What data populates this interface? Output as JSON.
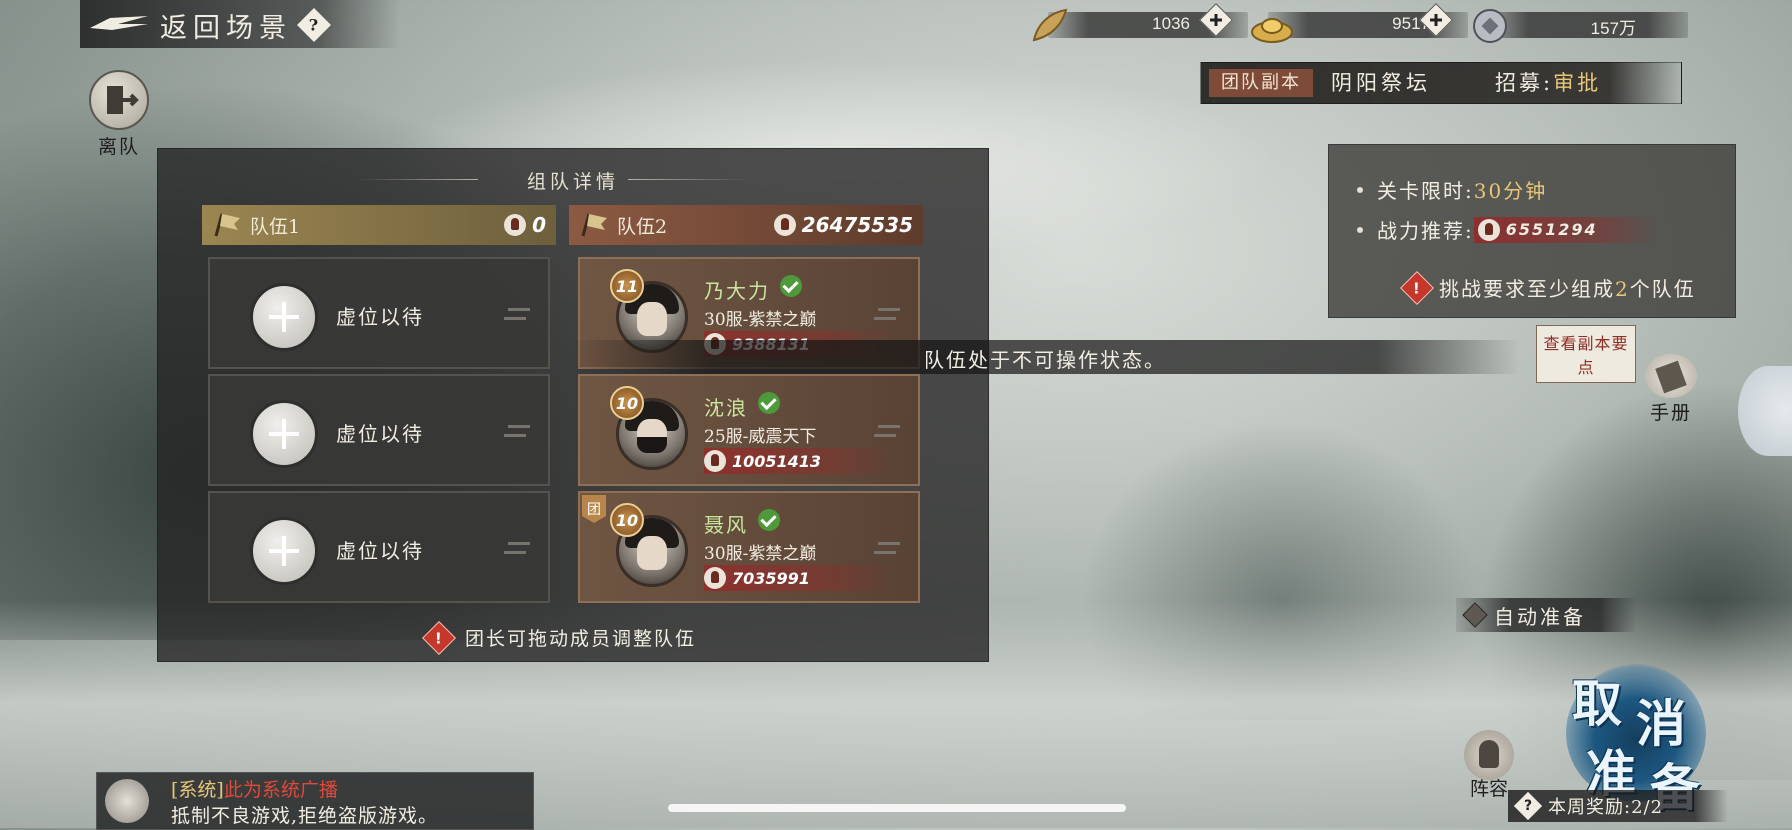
{
  "header": {
    "back_label": "返回场景",
    "help_label": "?"
  },
  "currencies": [
    {
      "icon": "leaf-currency-icon",
      "value": "1036"
    },
    {
      "icon": "gold-ingot-icon",
      "value": "9517"
    },
    {
      "icon": "coin-icon",
      "value": "157万"
    }
  ],
  "dungeon": {
    "tag": "团队副本",
    "name": "阴阳祭坛",
    "recruit_label": "招募:",
    "recruit_value": "审批"
  },
  "leave": {
    "label": "离队"
  },
  "panel": {
    "title": "组队详情",
    "hint": "团长可拖动成员调整队伍",
    "teams": [
      {
        "name": "队伍1",
        "power": "0",
        "slots": [
          {
            "label": "虚位以待"
          },
          {
            "label": "虚位以待"
          },
          {
            "label": "虚位以待"
          }
        ]
      },
      {
        "name": "队伍2",
        "power": "26475535",
        "members": [
          {
            "level": "11",
            "name": "乃大力",
            "server": "30服-紫禁之巅",
            "power": "9388131",
            "leader": false
          },
          {
            "level": "10",
            "name": "沈浪",
            "server": "25服-威震天下",
            "power": "10051413",
            "leader": false
          },
          {
            "level": "10",
            "name": "聂风",
            "server": "30服-紫禁之巅",
            "power": "7035991",
            "leader": true,
            "leader_badge": "团"
          }
        ]
      }
    ]
  },
  "toast": "队伍处于不可操作状态。",
  "info": {
    "time_limit_label": "关卡限时:",
    "time_limit_value": "30分钟",
    "power_rec_label": "战力推荐:",
    "power_rec_value": "6551294",
    "requirement_pre": "挑战要求至少组成",
    "requirement_num": "2",
    "requirement_post": "个队伍"
  },
  "guide_button": "查看副本要点",
  "manual_label": "手册",
  "auto_ready_label": "自动准备",
  "cancel_ready": {
    "c1": "取",
    "c2": "消",
    "c3": "准",
    "c4": "备"
  },
  "lineup_label": "阵容",
  "weekly_reward": "本周奖励:2/2",
  "chat": {
    "prefix": "[系统]",
    "highlight": "此为系统广播",
    "message": "抵制不良游戏,拒绝盗版游戏。"
  },
  "colors": {
    "accent_gold": "#e8c67a",
    "power_red": "#963028",
    "ready_green": "#4e9a3b",
    "cancel_blue": "#1c5780"
  }
}
